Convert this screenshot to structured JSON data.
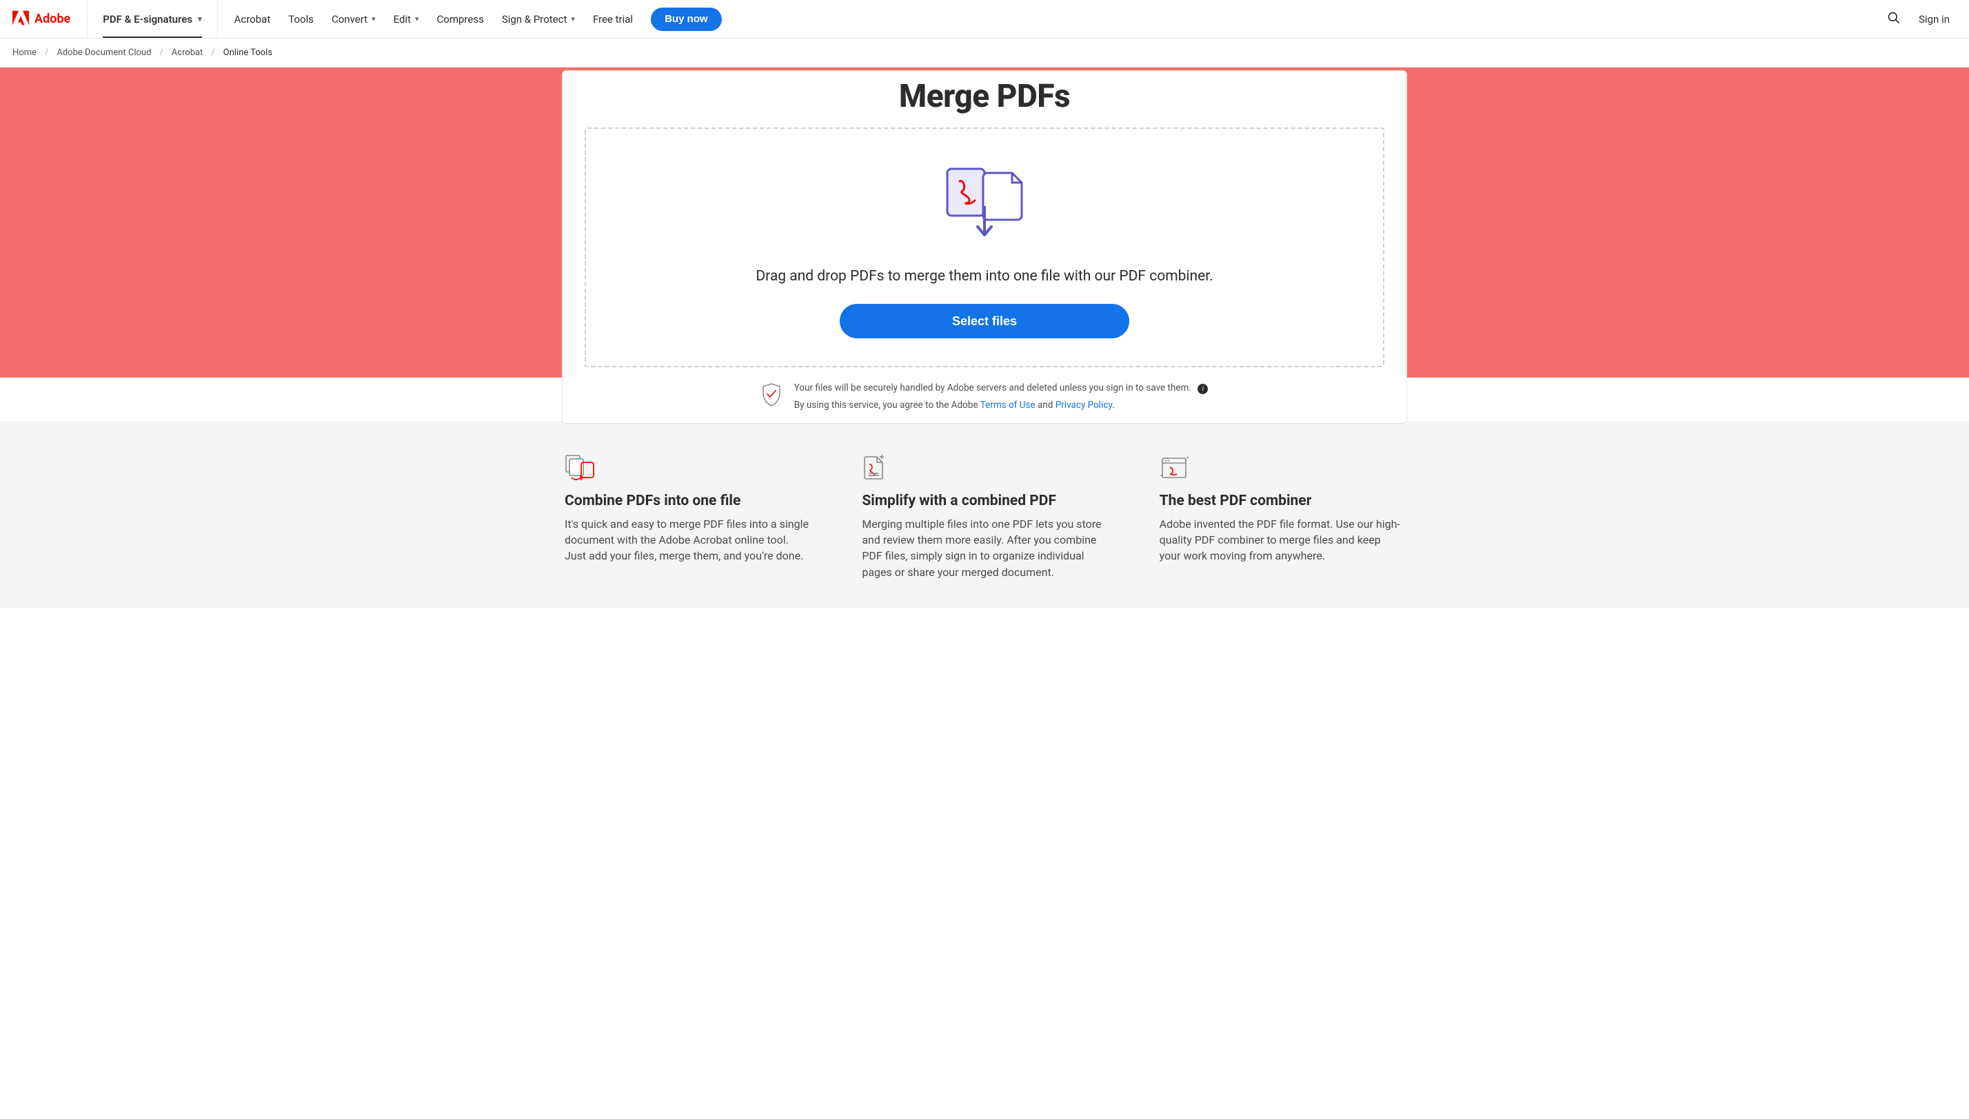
{
  "brand": "Adobe",
  "nav": {
    "active_tab": "PDF & E-signatures",
    "items": [
      "Acrobat",
      "Tools",
      "Convert",
      "Edit",
      "Compress",
      "Sign & Protect",
      "Free trial"
    ],
    "dropdowns": {
      "Convert": true,
      "Edit": true,
      "Sign & Protect": true
    },
    "buy_now": "Buy now",
    "sign_in": "Sign in"
  },
  "breadcrumb": [
    "Home",
    "Adobe Document Cloud",
    "Acrobat",
    "Online Tools"
  ],
  "hero": {
    "title": "Merge PDFs",
    "dropzone_text": "Drag and drop PDFs to merge them into one file with our PDF combiner.",
    "select_files": "Select files"
  },
  "notice": {
    "line1": "Your files will be securely handled by Adobe servers and deleted unless you sign in to save them.",
    "line2_pre": "By using this service, you agree to the Adobe ",
    "terms": "Terms of Use",
    "and": " and ",
    "privacy": "Privacy Policy",
    "dot": "."
  },
  "features": [
    {
      "title": "Combine PDFs into one file",
      "body": "It's quick and easy to merge PDF files into a single document with the Adobe Acrobat online tool. Just add your files, merge them, and you're done."
    },
    {
      "title": "Simplify with a combined PDF",
      "body": "Merging multiple files into one PDF lets you store and review them more easily. After you combine PDF files, simply sign in to organize individual pages or share your merged document."
    },
    {
      "title": "The best PDF combiner",
      "body": "Adobe invented the PDF file format. Use our high-quality PDF combiner to merge files and keep your work moving from anywhere."
    }
  ]
}
